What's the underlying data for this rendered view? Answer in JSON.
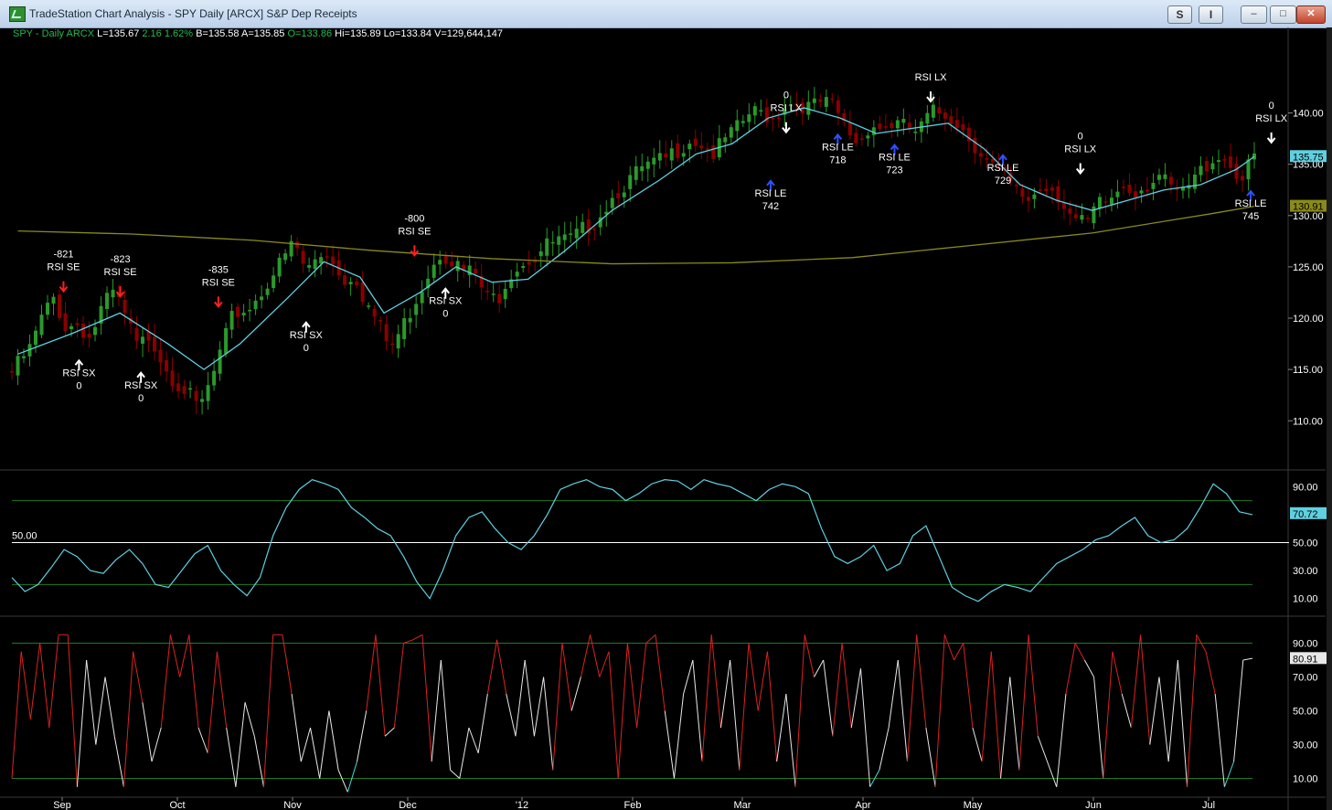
{
  "window": {
    "title": "TradeStation Chart Analysis - SPY Daily [ARCX] S&P Dep Receipts",
    "btn_s": "S",
    "btn_i": "I",
    "minimize": "‒",
    "maximize": "□",
    "close": "✕"
  },
  "info": {
    "symbol": "SPY - Daily  ARCX",
    "last": "L=135.67",
    "chg": "2.16",
    "pct": "1.62%",
    "bid": "B=135.58",
    "ask": "A=135.85",
    "open": "O=133.86",
    "high": "Hi=135.89",
    "low": "Lo=133.84",
    "volume": "V=129,644,147"
  },
  "colors": {
    "up": "#2a9a2a",
    "down": "#8b0000",
    "ma_short": "#5fd0e0",
    "ma_long": "#8a8a1a",
    "rsi_line": "#5fd0e0",
    "guide": "#1f7a1f",
    "stoch_mid": "#e8e8e8",
    "stoch_high": "#d22",
    "stoch_low": "#4dd",
    "axis_text": "#ffffff",
    "long_arrow": "#3050ff",
    "short_arrow": "#ff2020",
    "exit_arrow": "#ffffff"
  },
  "chart_data": [
    {
      "type": "candlestick",
      "panel": "price",
      "x_labels": [
        "Sep",
        "Oct",
        "Nov",
        "Dec",
        "'12",
        "Feb",
        "Mar",
        "Apr",
        "May",
        "Jun",
        "Jul"
      ],
      "ylim": [
        105.3,
        147.0
      ],
      "y_ticks": [
        "140.00",
        "135.00",
        "130.00",
        "125.00",
        "120.00",
        "115.00",
        "110.00"
      ],
      "price_labels": [
        {
          "value": "135.75",
          "y": 135.75,
          "color": "#5fd0e0"
        },
        {
          "value": "130.91",
          "y": 130.91,
          "color": "#8a8a1a"
        }
      ],
      "close_path": [
        [
          1,
          115.5
        ],
        [
          3,
          117
        ],
        [
          5,
          120
        ],
        [
          7,
          122
        ],
        [
          9,
          119
        ],
        [
          11,
          119.5
        ],
        [
          13,
          118
        ],
        [
          15,
          121
        ],
        [
          17,
          122.5
        ],
        [
          19,
          120
        ],
        [
          21,
          117
        ],
        [
          23,
          118.5
        ],
        [
          25,
          116
        ],
        [
          27,
          114
        ],
        [
          29,
          113
        ],
        [
          31,
          111
        ],
        [
          33,
          113.5
        ],
        [
          35,
          117
        ],
        [
          37,
          120.5
        ],
        [
          39,
          120.8
        ],
        [
          41,
          122
        ],
        [
          43,
          124
        ],
        [
          45,
          125.5
        ],
        [
          47,
          127.5
        ],
        [
          49,
          124.5
        ],
        [
          51,
          126
        ],
        [
          53,
          126.5
        ],
        [
          55,
          123.5
        ],
        [
          57,
          124.5
        ],
        [
          59,
          121.5
        ],
        [
          61,
          119.5
        ],
        [
          63,
          117
        ],
        [
          65,
          119
        ],
        [
          67,
          121.5
        ],
        [
          69,
          124
        ],
        [
          71,
          126.5
        ],
        [
          73,
          126
        ],
        [
          75,
          124.5
        ],
        [
          77,
          124.5
        ],
        [
          79,
          122
        ],
        [
          81,
          122
        ],
        [
          83,
          124.5
        ],
        [
          85,
          125.5
        ],
        [
          87,
          126
        ],
        [
          89,
          127
        ],
        [
          91,
          127.5
        ],
        [
          93,
          127.5
        ],
        [
          95,
          128.5
        ],
        [
          97,
          129.5
        ],
        [
          99,
          131
        ],
        [
          101,
          132.5
        ],
        [
          103,
          133.5
        ],
        [
          105,
          134.5
        ],
        [
          107,
          135
        ],
        [
          109,
          135.5
        ],
        [
          111,
          136.5
        ],
        [
          113,
          137.5
        ],
        [
          115,
          137
        ],
        [
          117,
          136
        ],
        [
          119,
          137.5
        ],
        [
          121,
          138.5
        ],
        [
          123,
          140
        ],
        [
          125,
          140
        ],
        [
          127,
          139.5
        ],
        [
          129,
          141
        ],
        [
          131,
          141
        ],
        [
          133,
          140.5
        ],
        [
          135,
          141
        ],
        [
          137,
          140.5
        ],
        [
          139,
          138.5
        ],
        [
          141,
          137
        ],
        [
          143,
          139
        ],
        [
          145,
          138.5
        ],
        [
          147,
          139
        ],
        [
          149,
          138.5
        ],
        [
          151,
          138
        ],
        [
          153,
          140
        ],
        [
          155,
          140
        ],
        [
          157,
          139.5
        ],
        [
          159,
          138
        ],
        [
          161,
          136.5
        ],
        [
          163,
          135
        ],
        [
          165,
          134
        ],
        [
          167,
          132.5
        ],
        [
          169,
          131.5
        ],
        [
          171,
          132.5
        ],
        [
          173,
          133
        ],
        [
          175,
          131.5
        ],
        [
          177,
          129.5
        ],
        [
          179,
          129
        ],
        [
          181,
          131
        ],
        [
          183,
          131.5
        ],
        [
          185,
          133
        ],
        [
          187,
          132.5
        ],
        [
          189,
          133
        ],
        [
          191,
          134
        ],
        [
          193,
          132.5
        ],
        [
          195,
          132
        ],
        [
          197,
          133.5
        ],
        [
          199,
          135
        ],
        [
          201,
          136
        ],
        [
          203,
          135
        ],
        [
          205,
          133.5
        ],
        [
          207,
          135.67
        ]
      ],
      "series": [
        {
          "name": "",
          "type": "ma",
          "color": "#5fd0e0",
          "points": [
            [
              1,
              116.5
            ],
            [
              10,
              118.5
            ],
            [
              18,
              120.5
            ],
            [
              26,
              117.5
            ],
            [
              32,
              115
            ],
            [
              38,
              117.5
            ],
            [
              46,
              122
            ],
            [
              52,
              125.5
            ],
            [
              58,
              124
            ],
            [
              62,
              120.5
            ],
            [
              68,
              122.5
            ],
            [
              74,
              125
            ],
            [
              80,
              123.5
            ],
            [
              86,
              123.8
            ],
            [
              92,
              126.5
            ],
            [
              100,
              130.5
            ],
            [
              108,
              133.5
            ],
            [
              114,
              136
            ],
            [
              120,
              137
            ],
            [
              126,
              139.5
            ],
            [
              132,
              140.5
            ],
            [
              138,
              139.5
            ],
            [
              144,
              138
            ],
            [
              150,
              138.5
            ],
            [
              156,
              139
            ],
            [
              162,
              136.5
            ],
            [
              168,
              133
            ],
            [
              174,
              131.5
            ],
            [
              180,
              130.5
            ],
            [
              186,
              131.5
            ],
            [
              192,
              132.5
            ],
            [
              198,
              133
            ],
            [
              204,
              134.5
            ],
            [
              207,
              135.75
            ]
          ]
        },
        {
          "name": "",
          "type": "ma",
          "color": "#8a8a1a",
          "points": [
            [
              1,
              128.5
            ],
            [
              20,
              128.2
            ],
            [
              40,
              127.6
            ],
            [
              60,
              126.6
            ],
            [
              80,
              125.8
            ],
            [
              100,
              125.3
            ],
            [
              120,
              125.4
            ],
            [
              140,
              125.9
            ],
            [
              160,
              127.1
            ],
            [
              180,
              128.3
            ],
            [
              200,
              130.2
            ],
            [
              207,
              130.91
            ]
          ]
        }
      ],
      "annotations": [
        {
          "label": "-821\nRSI SE",
          "x": 10,
          "dir": "short",
          "anchor": 122
        },
        {
          "label": "-823\nRSI SE",
          "x": 21,
          "dir": "short",
          "anchor": 121.5
        },
        {
          "label": "RSI SX\n0",
          "x": 13,
          "dir": "exit_up",
          "anchor": 116.5
        },
        {
          "label": "RSI SX\n0",
          "x": 25,
          "dir": "exit_up",
          "anchor": 115.3
        },
        {
          "label": "-835\nRSI SE",
          "x": 40,
          "dir": "short",
          "anchor": 120.5
        },
        {
          "label": "RSI SX\n0",
          "x": 57,
          "dir": "exit_up",
          "anchor": 120.2
        },
        {
          "label": "-800\nRSI SE",
          "x": 78,
          "dir": "short",
          "anchor": 125.5
        },
        {
          "label": "RSI SX\n0",
          "x": 84,
          "dir": "exit_up",
          "anchor": 123.5
        },
        {
          "label": "0\nRSI LX",
          "x": 150,
          "dir": "exit_down",
          "anchor": 137.5
        },
        {
          "label": "RSI LE\n742",
          "x": 147,
          "dir": "long",
          "anchor": 134
        },
        {
          "label": "RSI LE\n718",
          "x": 160,
          "dir": "long",
          "anchor": 138.5
        },
        {
          "label": "RSI LE\n723",
          "x": 171,
          "dir": "long",
          "anchor": 137.5
        },
        {
          "label": "RSI LX",
          "x": 178,
          "dir": "exit_down",
          "anchor": 140.5
        },
        {
          "label": "RSI LE\n729",
          "x": 192,
          "dir": "long",
          "anchor": 136.5
        },
        {
          "label": "0\nRSI LX",
          "x": 207,
          "dir": "exit_down",
          "anchor": 133.5
        },
        {
          "label": "RSI LE\n745",
          "x": 240,
          "dir": "long",
          "anchor": 133
        },
        {
          "label": "0\nRSI LX",
          "x": 244,
          "dir": "exit_down",
          "anchor": 136.5
        }
      ]
    },
    {
      "type": "line",
      "panel": "rsi",
      "ylim": [
        0,
        100
      ],
      "y_ticks": [
        "90.00",
        "50.00",
        "30.00",
        "10.00"
      ],
      "guides": [
        80,
        20
      ],
      "midline": {
        "value": 50,
        "label": "50.00"
      },
      "current": "70.72",
      "series": [
        {
          "name": "",
          "color": "#5fd0e0",
          "values": [
            25,
            15,
            20,
            32,
            45,
            40,
            30,
            28,
            38,
            45,
            35,
            20,
            18,
            30,
            42,
            48,
            30,
            20,
            12,
            25,
            55,
            75,
            88,
            95,
            92,
            88,
            75,
            68,
            60,
            55,
            40,
            22,
            10,
            30,
            55,
            68,
            72,
            60,
            50,
            45,
            55,
            70,
            88,
            92,
            95,
            90,
            88,
            80,
            85,
            92,
            95,
            94,
            88,
            95,
            92,
            90,
            85,
            80,
            88,
            92,
            90,
            85,
            60,
            40,
            35,
            40,
            48,
            30,
            35,
            55,
            62,
            40,
            18,
            12,
            8,
            15,
            20,
            18,
            15,
            25,
            35,
            40,
            45,
            52,
            55,
            62,
            68,
            55,
            50,
            52,
            60,
            75,
            92,
            85,
            72,
            70
          ]
        }
      ]
    },
    {
      "type": "line",
      "panel": "stochastic",
      "ylim": [
        0,
        100
      ],
      "y_ticks": [
        "90.00",
        "70.00",
        "50.00",
        "30.00",
        "10.00"
      ],
      "guides": [
        90,
        10
      ],
      "current": "80.91",
      "series": [
        {
          "name": "",
          "color": "#e8e8e8",
          "values": [
            10,
            85,
            45,
            90,
            40,
            95,
            95,
            5,
            80,
            30,
            70,
            35,
            5,
            85,
            55,
            20,
            40,
            95,
            70,
            95,
            40,
            25,
            85,
            40,
            5,
            55,
            35,
            5,
            95,
            95,
            60,
            20,
            40,
            10,
            50,
            15,
            2,
            20,
            50,
            95,
            35,
            40,
            90,
            92,
            95,
            20,
            80,
            15,
            10,
            40,
            25,
            60,
            92,
            60,
            35,
            80,
            35,
            70,
            15,
            90,
            50,
            70,
            95,
            70,
            85,
            10,
            90,
            40,
            90,
            95,
            50,
            10,
            60,
            80,
            20,
            95,
            40,
            80,
            15,
            90,
            50,
            85,
            20,
            60,
            5,
            95,
            70,
            80,
            35,
            90,
            40,
            75,
            5,
            15,
            40,
            80,
            20,
            95,
            40,
            5,
            95,
            80,
            90,
            40,
            20,
            85,
            10,
            70,
            15,
            95,
            35,
            20,
            5,
            60,
            90,
            80,
            70,
            10,
            85,
            60,
            40,
            95,
            30,
            70,
            20,
            80,
            5,
            95,
            85,
            60,
            5,
            20,
            80,
            81
          ]
        }
      ]
    }
  ]
}
